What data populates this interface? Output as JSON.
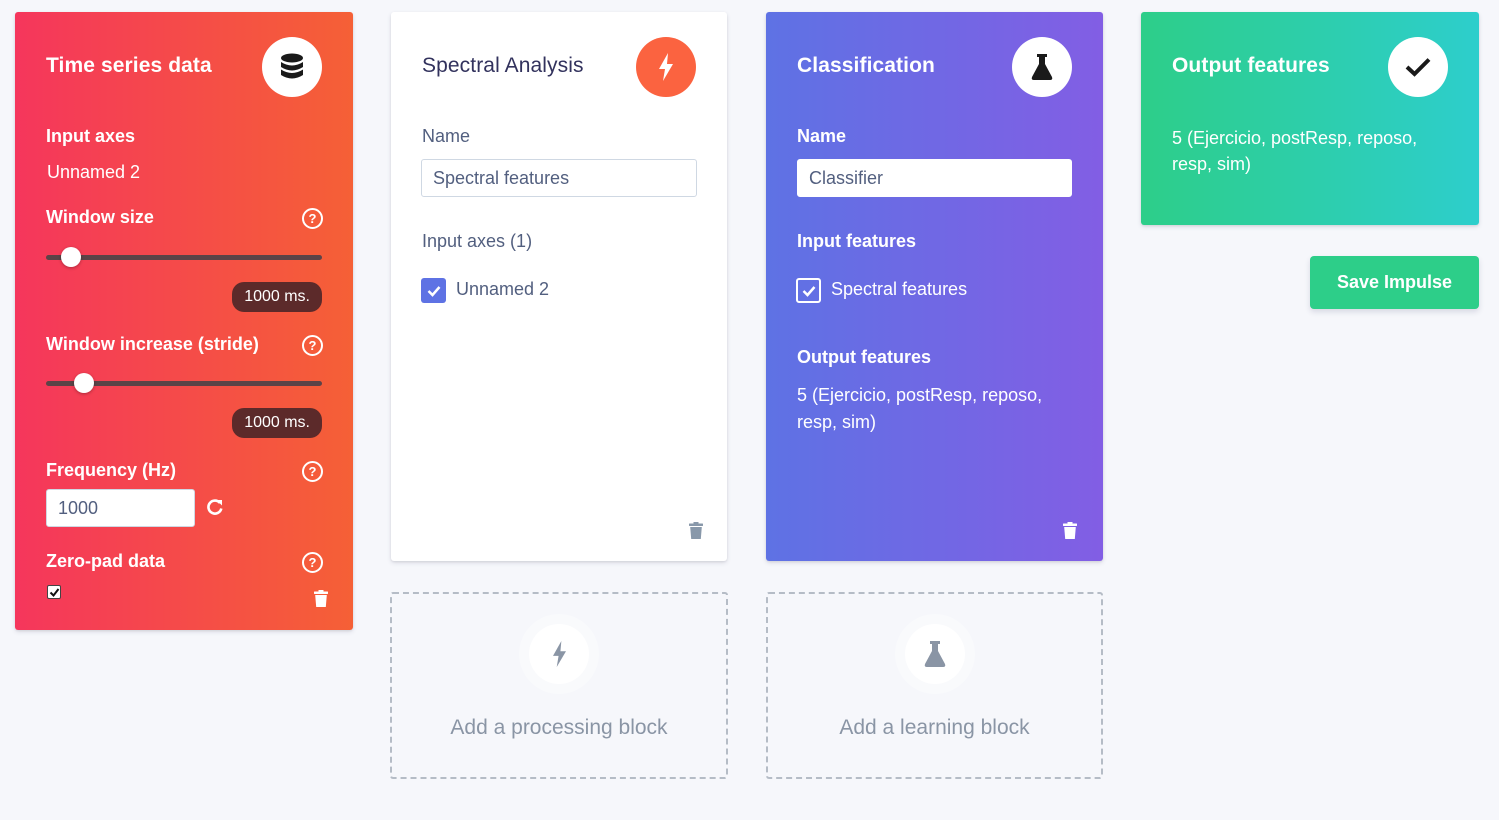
{
  "time_series": {
    "title": "Time series data",
    "icon": "database-icon",
    "input_axes_label": "Input axes",
    "input_axes_value": "Unnamed 2",
    "window_size_label": "Window size",
    "window_size_badge": "1000 ms.",
    "window_size_fraction": 0.06,
    "window_increase_label": "Window increase (stride)",
    "window_increase_badge": "1000 ms.",
    "window_increase_fraction": 0.11,
    "frequency_label": "Frequency (Hz)",
    "frequency_value": "1000",
    "zero_pad_label": "Zero-pad data",
    "zero_pad_checked": true,
    "help_glyph": "?"
  },
  "processing": {
    "title": "Spectral Analysis",
    "icon": "lightning-icon",
    "name_label": "Name",
    "name_value": "Spectral features",
    "input_axes_label": "Input axes (1)",
    "axis_item": "Unnamed 2"
  },
  "classification": {
    "title": "Classification",
    "icon": "flask-icon",
    "name_label": "Name",
    "name_value": "Classifier",
    "input_features_label": "Input features",
    "feature_item": "Spectral features",
    "output_features_label": "Output features",
    "output_features_value": "5 (Ejercicio, postResp, reposo, resp, sim)"
  },
  "output": {
    "title": "Output features",
    "icon": "checkmark-icon",
    "value": "5 (Ejercicio, postResp, reposo, resp, sim)"
  },
  "save_button": "Save Impulse",
  "add_processing": "Add a processing block",
  "add_learning": "Add a learning block",
  "colors": {
    "red_start": "#f5365c",
    "red_end": "#f56036",
    "purple_start": "#5e72e4",
    "purple_end": "#825ee4",
    "green_start": "#2dce89",
    "green_end": "#2dcecc",
    "orange": "#fb6340",
    "save_green": "#2dce89"
  }
}
